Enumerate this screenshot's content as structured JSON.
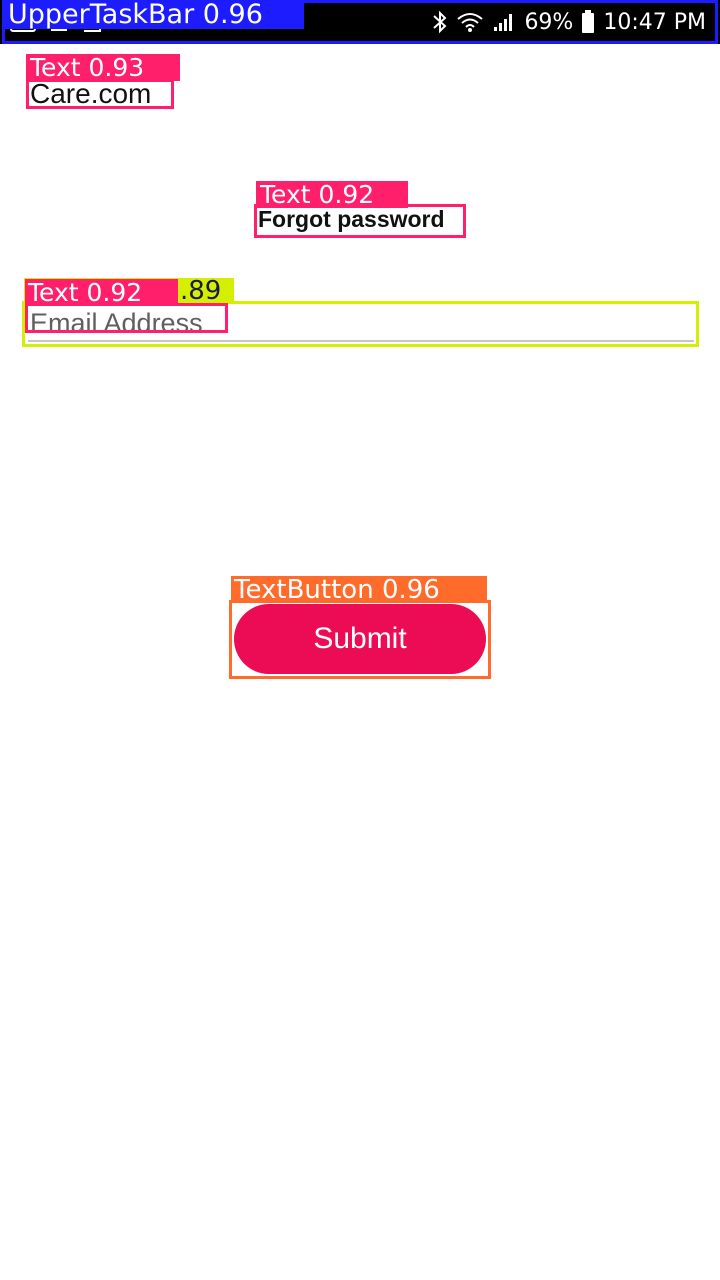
{
  "status_bar": {
    "battery": "69%",
    "time": "10:47 PM",
    "icons": [
      "bluetooth-icon",
      "wifi-icon",
      "signal-icon",
      "battery-icon"
    ]
  },
  "overlay": {
    "taskbar_tag": "UpperTaskBar 0.96",
    "brand_tag": "Text 0.93",
    "title_tag": "Text 0.92",
    "email_tag": "Text 0.92",
    "email_field_tag": ".89",
    "button_tag": "TextButton 0.96"
  },
  "colors": {
    "taskbar_box": "#1c1cff",
    "text_box": "#ff1f6b",
    "field_box": "#d4f000",
    "button_box": "#ff6b2a",
    "submit_button": "#ec0b55"
  },
  "header": {
    "brand": "Care.com"
  },
  "form": {
    "title": "Forgot password",
    "email_placeholder": "Email Address",
    "email_value": "",
    "submit_label": "Submit"
  }
}
